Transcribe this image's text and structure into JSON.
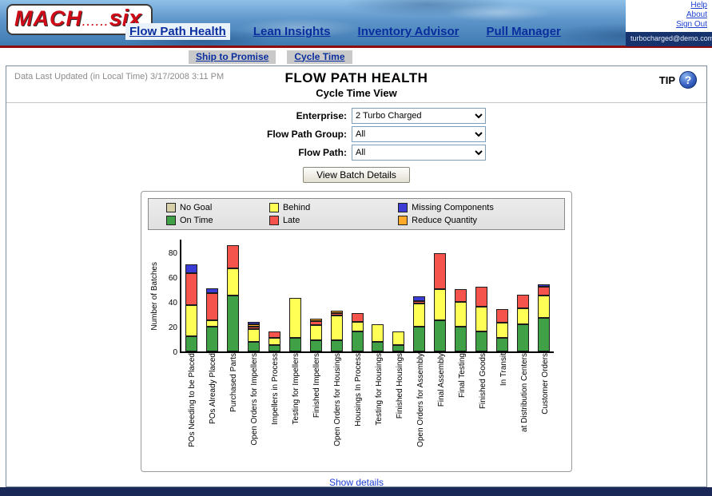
{
  "header": {
    "logo": {
      "part1": "MACH",
      "dots": "......",
      "part2": "six"
    },
    "nav": [
      {
        "label": "Flow Path Health",
        "active": true
      },
      {
        "label": "Lean Insights",
        "active": false
      },
      {
        "label": "Inventory Advisor",
        "active": false
      },
      {
        "label": "Pull Manager",
        "active": false
      }
    ],
    "account_links": [
      "Help",
      "About",
      "Sign Out"
    ],
    "user_email": "turbocharged@demo.com"
  },
  "subnav": [
    {
      "label": "Ship to Promise"
    },
    {
      "label": "Cycle Time"
    }
  ],
  "page": {
    "last_updated": "Data Last Updated (in Local Time) 3/17/2008 3:11 PM",
    "title": "FLOW PATH HEALTH",
    "subtitle": "Cycle Time View",
    "tip_label": "TIP",
    "tip_icon": "?",
    "filters": {
      "enterprise": {
        "label": "Enterprise:",
        "value": "2 Turbo Charged"
      },
      "flow_path_group": {
        "label": "Flow Path Group:",
        "value": "All"
      },
      "flow_path": {
        "label": "Flow Path:",
        "value": "All"
      }
    },
    "view_batch_details_button": "View Batch Details",
    "show_details_link": "Show details"
  },
  "chart_data": {
    "type": "bar",
    "stacked": true,
    "ylabel": "Number of Batches",
    "ylim": [
      0,
      90
    ],
    "yticks": [
      0,
      20,
      40,
      60,
      80
    ],
    "grid": false,
    "legend_position": "top",
    "categories": [
      "POs Needing to be Placed",
      "POs Already Placed",
      "Purchased Parts",
      "Open Orders for Impellers",
      "Impellers in Process",
      "Testing for Impellers",
      "Finished Impellers",
      "Open Orders for Housings",
      "Housings In Process",
      "Testing for Housings",
      "Finished Housings",
      "Open Orders for Assembly",
      "Final Assembly",
      "Final Testing",
      "Finished Goods",
      "In Transit",
      "at Distribution Centers",
      "Customer Orders"
    ],
    "series": [
      {
        "name": "On Time",
        "color": "#3fa045",
        "values": [
          12,
          20,
          45,
          8,
          5,
          11,
          9,
          9,
          16,
          8,
          5,
          20,
          25,
          20,
          16,
          11,
          22,
          27
        ]
      },
      {
        "name": "Behind",
        "color": "#ffff55",
        "values": [
          25,
          5,
          22,
          10,
          6,
          32,
          12,
          20,
          8,
          14,
          11,
          19,
          25,
          20,
          20,
          12,
          13,
          18
        ]
      },
      {
        "name": "Late",
        "color": "#f4544c",
        "values": [
          26,
          22,
          19,
          2,
          5,
          0,
          3,
          2,
          7,
          0,
          0,
          2,
          29,
          10,
          16,
          11,
          11,
          7
        ]
      },
      {
        "name": "Reduce Quantity",
        "color": "#ffa929",
        "values": [
          0,
          0,
          0,
          1,
          0,
          0,
          1,
          2,
          0,
          0,
          0,
          0,
          0,
          0,
          0,
          0,
          0,
          0
        ]
      },
      {
        "name": "Missing Components",
        "color": "#3b3bd6",
        "values": [
          7,
          4,
          0,
          2,
          0,
          0,
          0,
          0,
          0,
          0,
          0,
          4,
          0,
          0,
          0,
          0,
          0,
          1
        ]
      },
      {
        "name": "No Goal",
        "color": "#d6cfa8",
        "values": [
          0,
          0,
          0,
          0,
          0,
          0,
          0,
          0,
          0,
          0,
          0,
          0,
          0,
          0,
          0,
          0,
          0,
          0
        ]
      }
    ],
    "legend": [
      {
        "name": "No Goal",
        "color": "#d6cfa8"
      },
      {
        "name": "Behind",
        "color": "#ffff55"
      },
      {
        "name": "Missing Components",
        "color": "#3b3bd6"
      },
      {
        "name": "On Time",
        "color": "#3fa045"
      },
      {
        "name": "Late",
        "color": "#f4544c"
      },
      {
        "name": "Reduce Quantity",
        "color": "#ffa929"
      }
    ]
  }
}
